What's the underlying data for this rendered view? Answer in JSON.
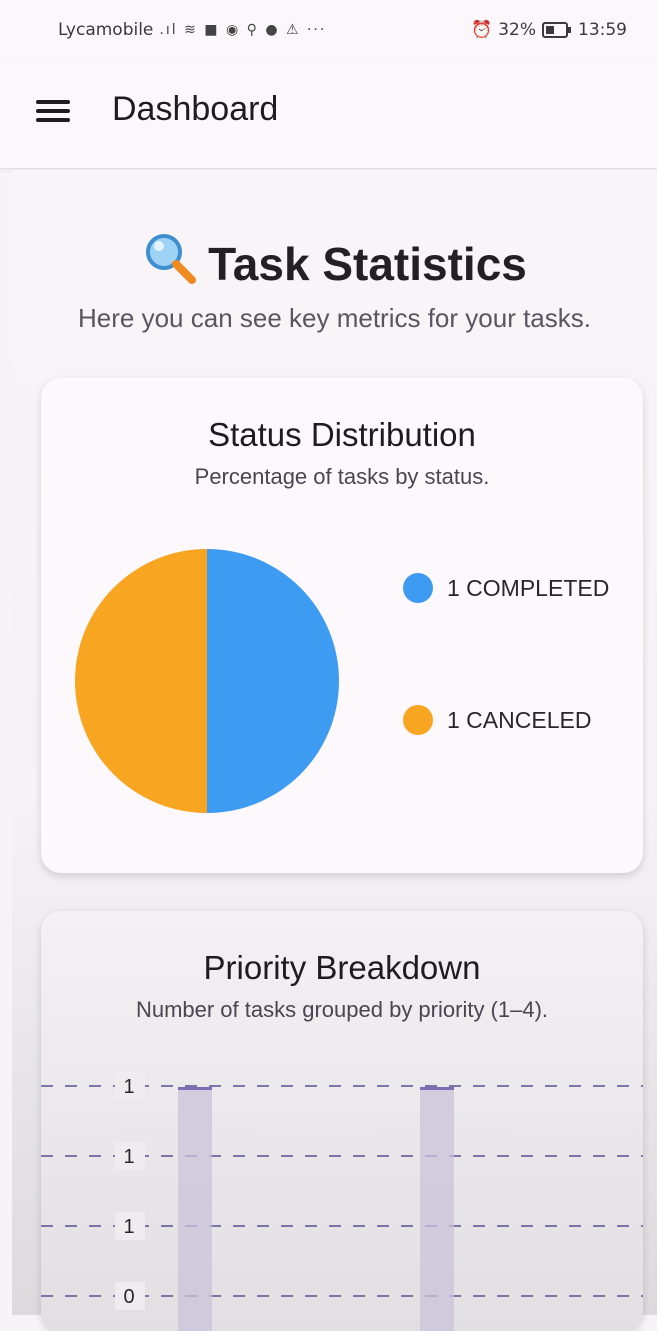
{
  "status_bar": {
    "carrier": "Lycamobile",
    "icons": ".ıl ≋ ■ ◉ ⚲ ● ⚠ ···",
    "battery": "32%",
    "time": "13:59"
  },
  "appbar": {
    "title": "Dashboard",
    "menu_icon": "hamburger-menu-icon"
  },
  "page": {
    "title": "Task Statistics",
    "title_icon": "magnifying-glass-icon",
    "subtitle": "Here you can see key metrics for your tasks."
  },
  "status_card": {
    "title": "Status Distribution",
    "subtitle": "Percentage of tasks by status."
  },
  "priority_card": {
    "title": "Priority Breakdown",
    "subtitle": "Number of tasks grouped by priority (1–4)."
  },
  "colors": {
    "completed": "#3d9bf2",
    "canceled": "#f8a521",
    "bar": "#c9c3d9",
    "bar_top": "#7a6db5"
  },
  "chart_data": [
    {
      "type": "pie",
      "categories": [
        "COMPLETED",
        "CANCELED"
      ],
      "values": [
        1,
        1
      ],
      "legend_labels": [
        "1 COMPLETED",
        "1 CANCELED"
      ],
      "legend": "right"
    },
    {
      "type": "bar",
      "y_tick_labels": [
        "1",
        "1",
        "1",
        "0"
      ],
      "values": [
        1,
        1
      ],
      "ylim": [
        0,
        1
      ],
      "grid": true
    }
  ]
}
